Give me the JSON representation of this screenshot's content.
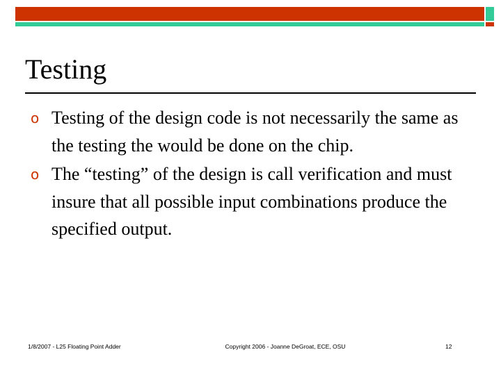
{
  "slide": {
    "title": "Testing",
    "bullets": [
      {
        "marker": "o",
        "text": "Testing of the design code is not necessarily the same as the testing the would be done on the chip."
      },
      {
        "marker": "o",
        "text": "The “testing” of the design is call verification and must insure that all possible input combinations produce the specified output."
      }
    ],
    "footer": {
      "left": "1/8/2007 - L25 Floating Point Adder",
      "center": "Copyright 2006 - Joanne DeGroat, ECE, OSU",
      "right": "12"
    },
    "colors": {
      "banner_red": "#cc3300",
      "banner_teal": "#33cc99",
      "bullet_marker": "#cc3300",
      "text": "#000000",
      "background": "#ffffff"
    }
  }
}
